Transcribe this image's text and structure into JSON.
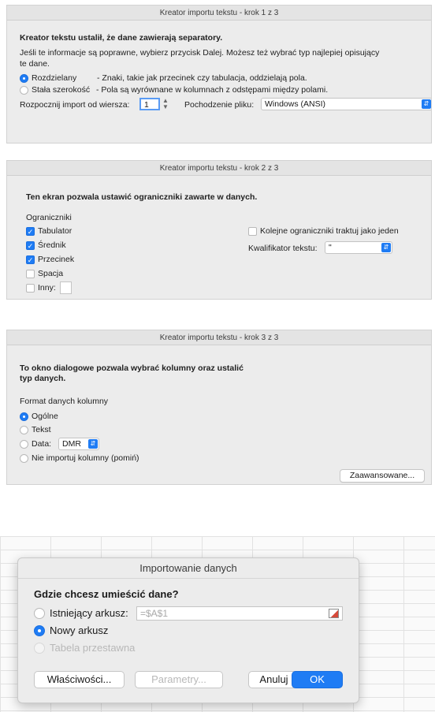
{
  "step1": {
    "title": "Kreator importu tekstu - krok 1 z 3",
    "heading": "Kreator tekstu ustalił, że dane zawierają separatory.",
    "desc_line1": "Jeśli te informacje są poprawne, wybierz przycisk Dalej. Możesz też wybrać typ najlepiej opisujący",
    "desc_line2": "te dane.",
    "opt_delimited_label": "Rozdzielany",
    "opt_delimited_desc": "- Znaki, takie jak przecinek czy tabulacja, oddzielają pola.",
    "opt_fixed_label": "Stała szerokość",
    "opt_fixed_desc": "- Pola są wyrównane w kolumnach z odstępami między polami.",
    "start_row_label": "Rozpocznij import od wiersza:",
    "start_row_value": "1",
    "origin_label": "Pochodzenie pliku:",
    "origin_value": "Windows (ANSI)"
  },
  "step2": {
    "title": "Kreator importu tekstu - krok 2 z 3",
    "heading": "Ten ekran pozwala ustawić ograniczniki zawarte w danych.",
    "group_label": "Ograniczniki",
    "tab": "Tabulator",
    "semicolon": "Średnik",
    "comma": "Przecinek",
    "space": "Spacja",
    "other": "Inny:",
    "consecutive": "Kolejne ograniczniki traktuj jako jeden",
    "qualifier_label": "Kwalifikator tekstu:",
    "qualifier_value": "\""
  },
  "step3": {
    "title": "Kreator importu tekstu - krok 3 z 3",
    "heading_line1": "To okno dialogowe pozwala wybrać kolumny oraz ustalić",
    "heading_line2": "typ danych.",
    "group_label": "Format danych kolumny",
    "general": "Ogólne",
    "text": "Tekst",
    "date": "Data:",
    "date_format": "DMR",
    "skip": "Nie importuj kolumny (pomiń)",
    "advanced_btn": "Zaawansowane..."
  },
  "import": {
    "title": "Importowanie danych",
    "question": "Gdzie chcesz umieścić dane?",
    "existing": "Istniejący arkusz:",
    "existing_ref": "=$A$1",
    "new_sheet": "Nowy arkusz",
    "pivot": "Tabela przestawna",
    "properties_btn": "Właściwości...",
    "params_btn": "Parametry...",
    "cancel_btn": "Anuluj",
    "ok_btn": "OK"
  },
  "colors": {
    "accent": "#1f7cf4",
    "dialog_bg": "#ececec"
  }
}
